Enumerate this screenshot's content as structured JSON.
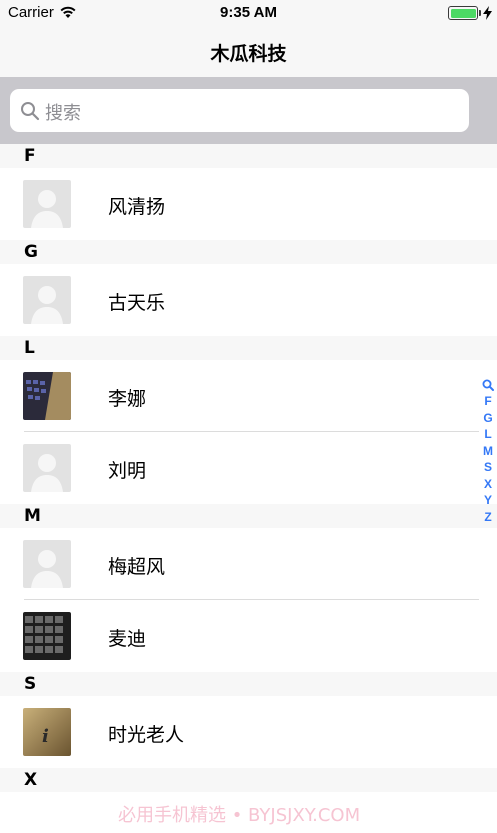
{
  "status_bar": {
    "carrier": "Carrier",
    "time": "9:35 AM",
    "battery_color": "#4cd964"
  },
  "nav": {
    "title": "木瓜科技"
  },
  "search": {
    "placeholder": "搜索"
  },
  "sections": [
    {
      "letter": "F",
      "contacts": [
        {
          "name": "风清扬",
          "avatar": "placeholder-avatar"
        }
      ]
    },
    {
      "letter": "G",
      "contacts": [
        {
          "name": "古天乐",
          "avatar": "placeholder-avatar"
        }
      ]
    },
    {
      "letter": "L",
      "contacts": [
        {
          "name": "李娜",
          "avatar": "keyboard-photo"
        },
        {
          "name": "刘明",
          "avatar": "placeholder-avatar"
        }
      ]
    },
    {
      "letter": "M",
      "contacts": [
        {
          "name": "梅超风",
          "avatar": "placeholder-avatar"
        },
        {
          "name": "麦迪",
          "avatar": "keys-photo"
        }
      ]
    },
    {
      "letter": "S",
      "contacts": [
        {
          "name": "时光老人",
          "avatar": "info-photo"
        }
      ]
    },
    {
      "letter": "X",
      "contacts": []
    }
  ],
  "index_bar": {
    "letters": [
      "F",
      "G",
      "L",
      "M",
      "S",
      "X",
      "Y",
      "Z"
    ],
    "accent_color": "#3478f6"
  },
  "watermark": "必用手机精选 • BYJSJXY.COM"
}
